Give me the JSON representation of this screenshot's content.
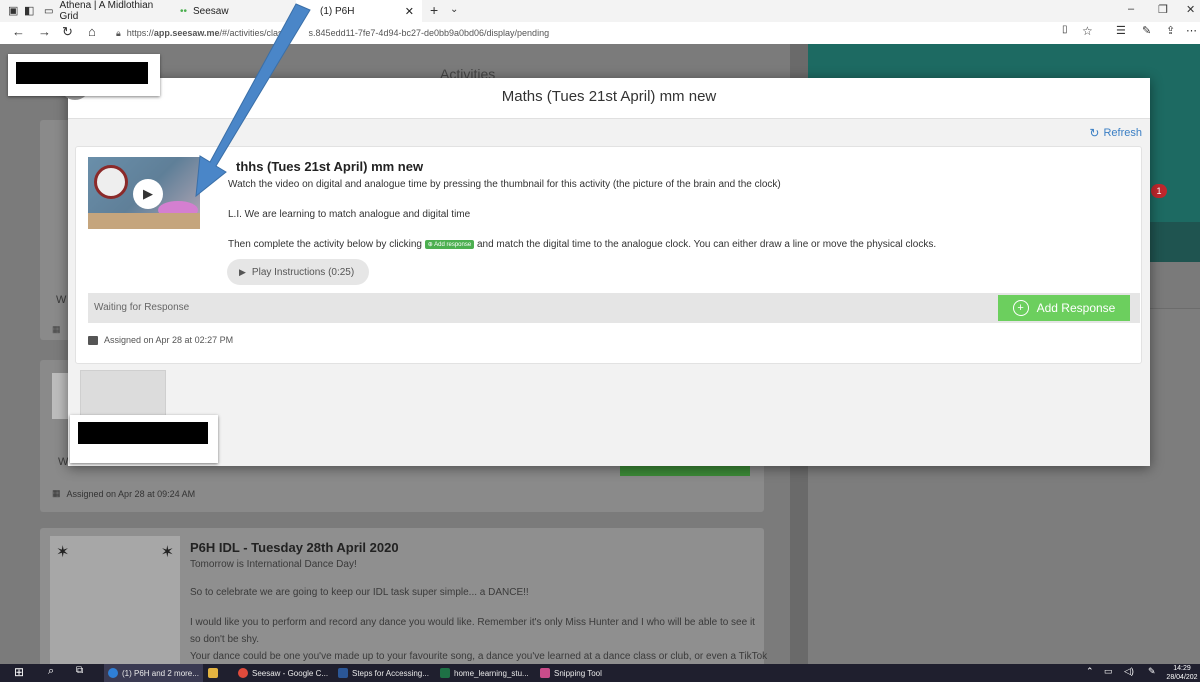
{
  "browser": {
    "tabs": [
      {
        "label": "Athena | A Midlothian Grid"
      },
      {
        "label": "Seesaw"
      },
      {
        "label": "(1) P6H"
      }
    ],
    "url_prefix": "https://",
    "url_domain": "app.seesaw.me",
    "url_path": "/#/activities/clas",
    "url_rest": "s.845edd11-7fe7-4d94-bc27-de0bb9a0bd06/display/pending"
  },
  "background": {
    "activities_heading": "Activities",
    "notification_count": "1",
    "truncated_w": "W",
    "waiting_truncated": "W",
    "assigned_behind": "Assigned on Apr 28 at 09:24 AM",
    "post_title": "P6H IDL - Tuesday 28th April 2020",
    "post_lines": [
      "Tomorrow is International Dance Day!",
      "So to celebrate we are going to keep our IDL task super simple... a DANCE!!",
      "I would like you to perform and record any dance you would like. Remember it's only Miss Hunter and I who will be able to see it",
      "so don't be shy.",
      "Your dance could be one you've made up to your favourite song, a dance you've learned at a dance class or club, or even a TikTok"
    ]
  },
  "modal": {
    "title": "Maths (Tues 21st April) mm new",
    "refresh_label": "Refresh",
    "activity_title": "thhs (Tues 21st April) mm new",
    "line1": "Watch the video on digital and analogue time by pressing the thumbnail for this activity (the picture of the brain and the clock)",
    "line2": "L.I. We are learning to match analogue and digital time",
    "line3_a": "Then complete the activity below by clicking",
    "line3_badge": "Add response",
    "line3_b": "and match the digital time to the analogue clock. You can either draw a line or move the physical clocks.",
    "play_instructions": "Play Instructions (0:25)",
    "waiting": "Waiting for Response",
    "add_response": "Add Response",
    "assigned": "Assigned on Apr 28 at 02:27 PM"
  },
  "taskbar": {
    "items": [
      {
        "label": "(1) P6H and 2 more..."
      },
      {
        "label": "Seesaw - Google C..."
      },
      {
        "label": "Steps for Accessing..."
      },
      {
        "label": "home_learning_stu..."
      },
      {
        "label": "Snipping Tool"
      }
    ],
    "time": "14:29",
    "date": "28/04/202"
  },
  "colors": {
    "accent_blue": "#3b7fc4",
    "add_green": "#6ccf5e",
    "teal": "#1d6a62",
    "arrow": "#4a86c8"
  }
}
